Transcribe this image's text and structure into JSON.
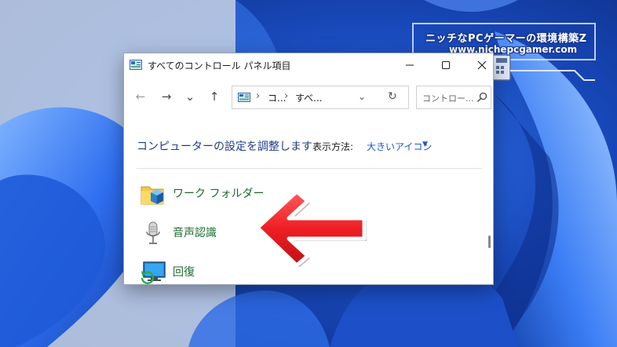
{
  "watermark": {
    "line1": "ニッチなPCゲーマーの環境構築Z",
    "line2": "www.nichepcgamer.com"
  },
  "window": {
    "title": "すべてのコントロール パネル項目",
    "controls": {
      "minimize": "—",
      "maximize": "☐",
      "close": "✕"
    }
  },
  "navigation": {
    "back": "←",
    "forward": "→",
    "recent": "⌄",
    "up": "↑",
    "address": {
      "crumb1": "コ...",
      "crumb2": "すべ...",
      "separator": "›",
      "dropdown": "⌄",
      "refresh": "↻"
    },
    "search": {
      "placeholder": "コントロー..."
    }
  },
  "content": {
    "heading": "コンピューターの設定を調整します",
    "view_by": {
      "label": "表示方法:",
      "value": "大きいアイコン",
      "caret": "▼"
    },
    "items": [
      {
        "label": "ワーク フォルダー",
        "icon": "work-folders-icon"
      },
      {
        "label": "音声認識",
        "icon": "microphone-icon"
      },
      {
        "label": "回復",
        "icon": "recovery-icon"
      }
    ]
  },
  "annotation": {
    "icon": "red-arrow-icon",
    "color": "#ee1f24"
  },
  "colors": {
    "heading": "#1e3a8a",
    "link": "#1e56c8",
    "item_label": "#1b6a2d"
  }
}
